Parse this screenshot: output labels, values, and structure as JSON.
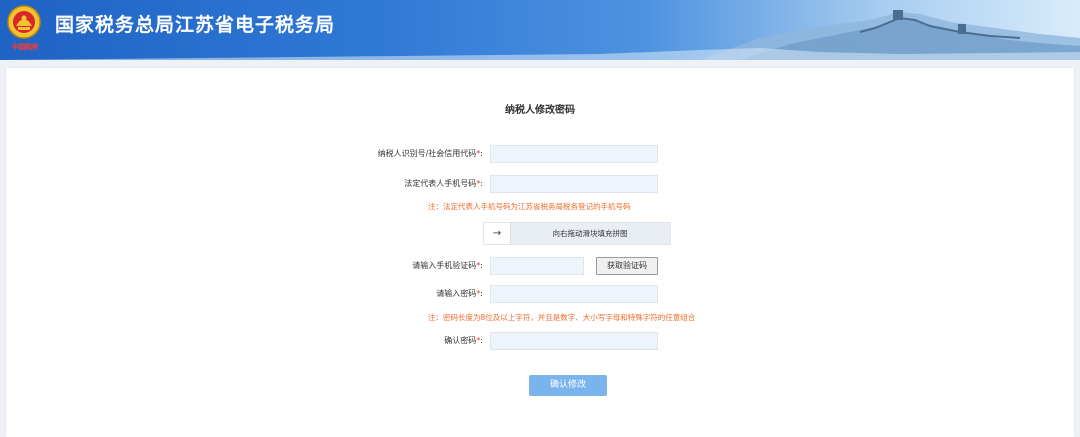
{
  "header": {
    "title": "国家税务总局江苏省电子税务局",
    "emblem_caption": "中国税务",
    "emblem_icon": "tax-emblem-icon",
    "colors": {
      "banner_start": "#1f63c4",
      "banner_end": "#d9ecfb"
    }
  },
  "form": {
    "title": "纳税人修改密码",
    "required_mark": "*",
    "fields": {
      "taxpayer_id": {
        "label": "纳税人识别号/社会信用代码",
        "value": "",
        "placeholder": ""
      },
      "legal_phone": {
        "label": "法定代表人手机号码",
        "value": "",
        "placeholder": ""
      },
      "sms_code": {
        "label": "请输入手机验证码",
        "value": "",
        "placeholder": ""
      },
      "password": {
        "label": "请输入密码",
        "value": "",
        "placeholder": ""
      },
      "confirm_password": {
        "label": "确认密码",
        "value": "",
        "placeholder": ""
      }
    },
    "notes": {
      "phone_note": "注：法定代表人手机号码为江苏省税务局税务登记的手机号码",
      "password_note": "注：密码长度为8位及以上字符，并且是数字、大小写字母和特殊字符的任意组合"
    },
    "slider": {
      "handle_icon": "arrow-right-icon",
      "handle_glyph": "→",
      "hint": "向右拖动滑块填充拼图"
    },
    "sms_button_label": "获取验证码",
    "colon": ":",
    "submit_label": "确认修改",
    "colors": {
      "submit": "#79b5ec",
      "note": "#f06a2a",
      "required": "#e03a2e"
    }
  }
}
